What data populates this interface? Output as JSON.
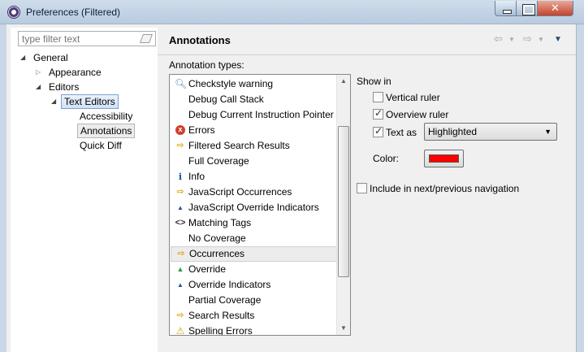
{
  "window": {
    "title": "Preferences (Filtered)"
  },
  "filter": {
    "placeholder": "type filter text"
  },
  "tree": [
    {
      "label": "General",
      "level": 0,
      "expanded": true
    },
    {
      "label": "Appearance",
      "level": 1,
      "expanded": false
    },
    {
      "label": "Editors",
      "level": 1,
      "expanded": true
    },
    {
      "label": "Text Editors",
      "level": 2,
      "expanded": true,
      "selected": true
    },
    {
      "label": "Accessibility",
      "level": 3
    },
    {
      "label": "Annotations",
      "level": 3,
      "hot": true
    },
    {
      "label": "Quick Diff",
      "level": 3
    }
  ],
  "page": {
    "title": "Annotations",
    "section_label": "Annotation types:"
  },
  "annotation_types": [
    {
      "label": "Checkstyle warning",
      "icon": "magnifier-icon"
    },
    {
      "label": "Debug Call Stack",
      "icon": "none"
    },
    {
      "label": "Debug Current Instruction Pointer",
      "icon": "none"
    },
    {
      "label": "Errors",
      "icon": "error-icon"
    },
    {
      "label": "Filtered Search Results",
      "icon": "arrow-icon"
    },
    {
      "label": "Full Coverage",
      "icon": "none"
    },
    {
      "label": "Info",
      "icon": "info-icon"
    },
    {
      "label": "JavaScript Occurrences",
      "icon": "arrow-icon"
    },
    {
      "label": "JavaScript Override Indicators",
      "icon": "blue-triangle-icon"
    },
    {
      "label": "Matching Tags",
      "icon": "tags-icon"
    },
    {
      "label": "No Coverage",
      "icon": "none"
    },
    {
      "label": "Occurrences",
      "icon": "arrow-icon",
      "hot": true
    },
    {
      "label": "Override",
      "icon": "green-triangle-icon"
    },
    {
      "label": "Override Indicators",
      "icon": "blue-triangle-icon"
    },
    {
      "label": "Partial Coverage",
      "icon": "none"
    },
    {
      "label": "Search Results",
      "icon": "arrow-icon"
    },
    {
      "label": "Spelling Errors",
      "icon": "warning-icon"
    }
  ],
  "options": {
    "show_in": "Show in",
    "vertical_ruler": {
      "label": "Vertical ruler",
      "checked": false
    },
    "overview_ruler": {
      "label": "Overview ruler",
      "checked": true
    },
    "text_as": {
      "label": "Text as",
      "checked": true,
      "value": "Highlighted"
    },
    "color_label": "Color:",
    "color_value": "#ff0000",
    "include_nav": {
      "label": "Include in next/previous navigation",
      "checked": false
    }
  }
}
